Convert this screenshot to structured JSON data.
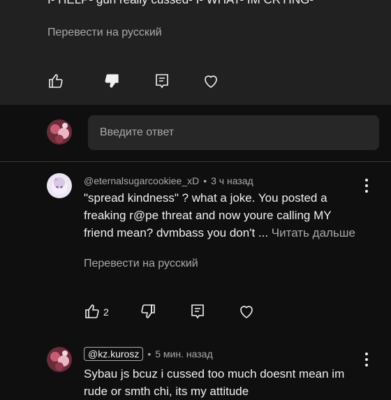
{
  "prev_comment": {
    "text_cut": "I- HELP- gurl really cussed- I- WHAT- IM CRYING-",
    "translate": "Перевести на русский"
  },
  "reply": {
    "placeholder": "Введите ответ"
  },
  "comments": [
    {
      "author": "@eternalsugarcookiee_xD",
      "time": "3 ч назад",
      "separator": "•",
      "text": "\"spread kindness\" ? what a joke. You posted a freaking r@pe threat and now youre calling MY friend mean? dvmbass you don't ...",
      "read_more": "Читать дальше",
      "translate": "Перевести на русский",
      "likes": "2"
    },
    {
      "author": "@kz.kurosz",
      "time": "5 мин. назад",
      "separator": "•",
      "text": "Sybau js bcuz i cussed too much doesnt mean im rude or smth chi, its my attitude"
    }
  ],
  "icons": {
    "like": "thumb-up-icon",
    "dislike": "thumb-down-icon",
    "reply": "comment-icon",
    "heart": "heart-icon",
    "more": "more-vert-icon"
  },
  "colors": {
    "panel": "#212121",
    "background": "#0f0f0f",
    "input": "#272727",
    "text_primary": "#f1f1f1",
    "text_secondary": "#aaaaaa"
  }
}
